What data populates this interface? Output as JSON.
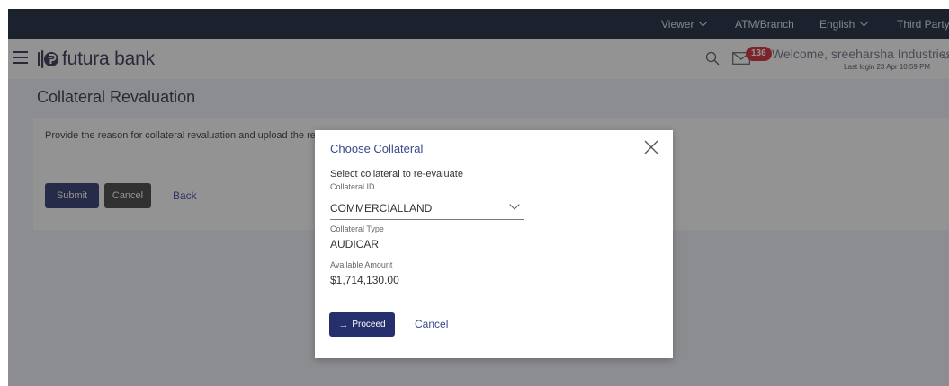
{
  "topbar": {
    "viewer": "Viewer",
    "atm_branch": "ATM/Branch",
    "language": "English",
    "third_party": "Third Party"
  },
  "header": {
    "logo_text": "futura bank",
    "notification_count": "136",
    "welcome": "Welcome, sreeharsha Industries2",
    "last_login": "Last login 23 Apr 10:59 PM"
  },
  "page": {
    "title": "Collateral Revaluation",
    "message": "Provide the reason for collateral revaluation and upload the required",
    "submit_label": "Submit",
    "cancel_label": "Cancel",
    "back_label": "Back"
  },
  "modal": {
    "title": "Choose Collateral",
    "subtitle": "Select collateral to re-evaluate",
    "collateral_id_label": "Collateral ID",
    "collateral_id_value": "COMMERCIALLAND",
    "collateral_type_label": "Collateral Type",
    "collateral_type_value": "AUDICAR",
    "available_amount_label": "Available Amount",
    "available_amount_value": "$1,714,130.00",
    "proceed_label": "Proceed",
    "cancel_label": "Cancel"
  },
  "colors": {
    "topbar_bg": "#0f1a33",
    "primary_button": "#252f6b",
    "secondary_button": "#3b3b3b",
    "badge": "#d11f2f",
    "link": "#3a4a8c"
  },
  "icons": [
    "hamburger-icon",
    "futura-logo-icon",
    "search-icon",
    "mail-icon",
    "close-icon",
    "chevron-down-icon",
    "arrow-right-icon"
  ]
}
